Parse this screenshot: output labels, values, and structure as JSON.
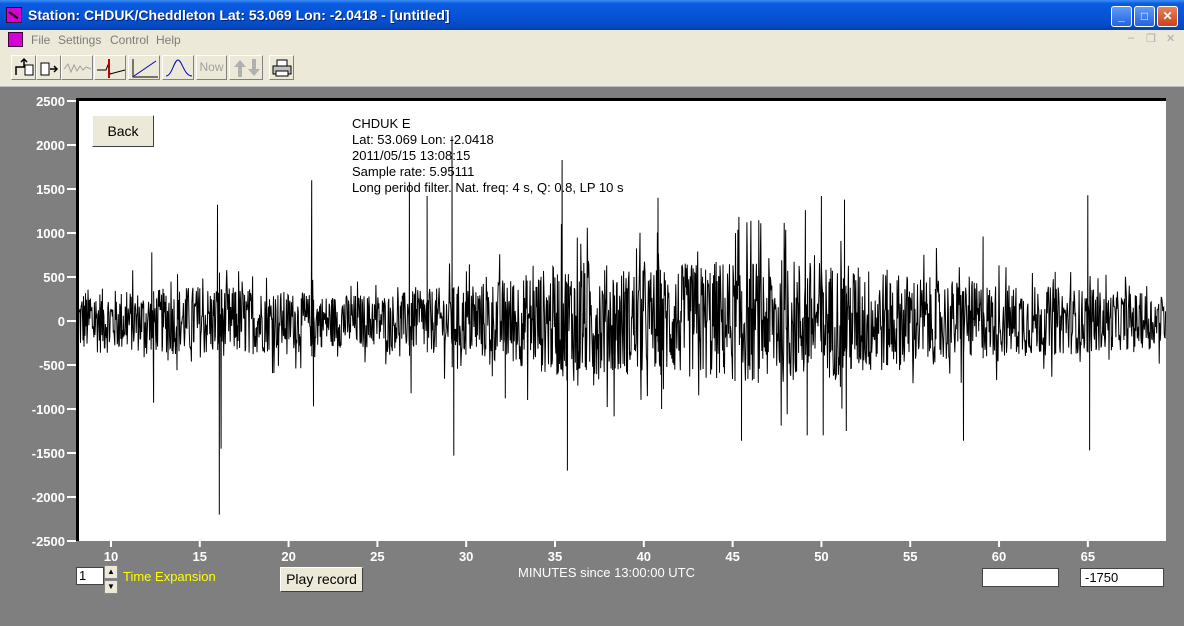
{
  "window": {
    "title": "Station: CHDUK/Cheddleton Lat: 53.069 Lon: -2.0418 - [untitled]",
    "min_glyph": "_",
    "max_glyph": "□",
    "close_glyph": "✕"
  },
  "menu": {
    "items": [
      "File",
      "Settings",
      "Control",
      "Help"
    ]
  },
  "toolbar": {
    "now_label": "Now"
  },
  "info": {
    "station": "CHDUK  E",
    "location": "Lat: 53.069 Lon: -2.0418",
    "datetime": "2011/05/15 13:08:15",
    "sample_rate": "Sample rate: 5.95111",
    "filter": "Long period filter. Nat. freq: 4 s, Q: 0.8, LP 10 s"
  },
  "controls": {
    "back_label": "Back",
    "time_expansion_value": "1",
    "time_expansion_label": "Time Expansion",
    "play_label": "Play record",
    "field_a_value": "",
    "field_b_value": "-1750"
  },
  "colors": {
    "trace": "#000000",
    "plot_bg": "#ffffff",
    "frame_bg": "#7f7f7f",
    "label_yellow": "#ffff00"
  },
  "chart_data": {
    "type": "line",
    "xlabel": "MINUTES since 13:00:00 UTC",
    "ylabel": "",
    "xlim": [
      8.2,
      69.4
    ],
    "ylim": [
      -2500,
      2500
    ],
    "yticks": [
      2500,
      2000,
      1500,
      1000,
      500,
      0,
      -500,
      -1000,
      -1500,
      -2000,
      -2500
    ],
    "xticks": [
      10,
      15,
      20,
      25,
      30,
      35,
      40,
      45,
      50,
      55,
      60,
      65
    ],
    "grid": false,
    "series": [
      {
        "noise": [
          [
            8.2,
            380
          ],
          [
            12,
            350
          ],
          [
            15,
            420
          ],
          [
            18,
            380
          ],
          [
            22,
            300
          ],
          [
            26,
            320
          ],
          [
            30,
            420
          ],
          [
            33,
            520
          ],
          [
            36,
            700
          ],
          [
            40,
            600
          ],
          [
            44,
            700
          ],
          [
            48,
            720
          ],
          [
            52,
            650
          ],
          [
            56,
            500
          ],
          [
            60,
            430
          ],
          [
            64,
            380
          ],
          [
            67,
            330
          ],
          [
            69.4,
            300
          ]
        ],
        "spikes": [
          [
            12.3,
            780
          ],
          [
            12.4,
            -930
          ],
          [
            16.0,
            1320
          ],
          [
            16.1,
            -2200
          ],
          [
            16.2,
            -1450
          ],
          [
            21.3,
            1600
          ],
          [
            21.4,
            -970
          ],
          [
            26.8,
            1580
          ],
          [
            26.9,
            -820
          ],
          [
            27.8,
            1420
          ],
          [
            29.2,
            2100
          ],
          [
            29.3,
            -1530
          ],
          [
            32.2,
            -880
          ],
          [
            35.4,
            1830
          ],
          [
            35.7,
            -1700
          ],
          [
            40.8,
            1400
          ],
          [
            41.0,
            -1000
          ],
          [
            45.5,
            -1360
          ],
          [
            49.1,
            1260
          ],
          [
            49.2,
            -1300
          ],
          [
            50.0,
            1420
          ],
          [
            50.1,
            -1300
          ],
          [
            51.3,
            1380
          ],
          [
            51.4,
            -1250
          ],
          [
            58.0,
            -1360
          ],
          [
            59.1,
            960
          ],
          [
            65.0,
            1430
          ],
          [
            65.1,
            -1470
          ]
        ]
      }
    ]
  }
}
